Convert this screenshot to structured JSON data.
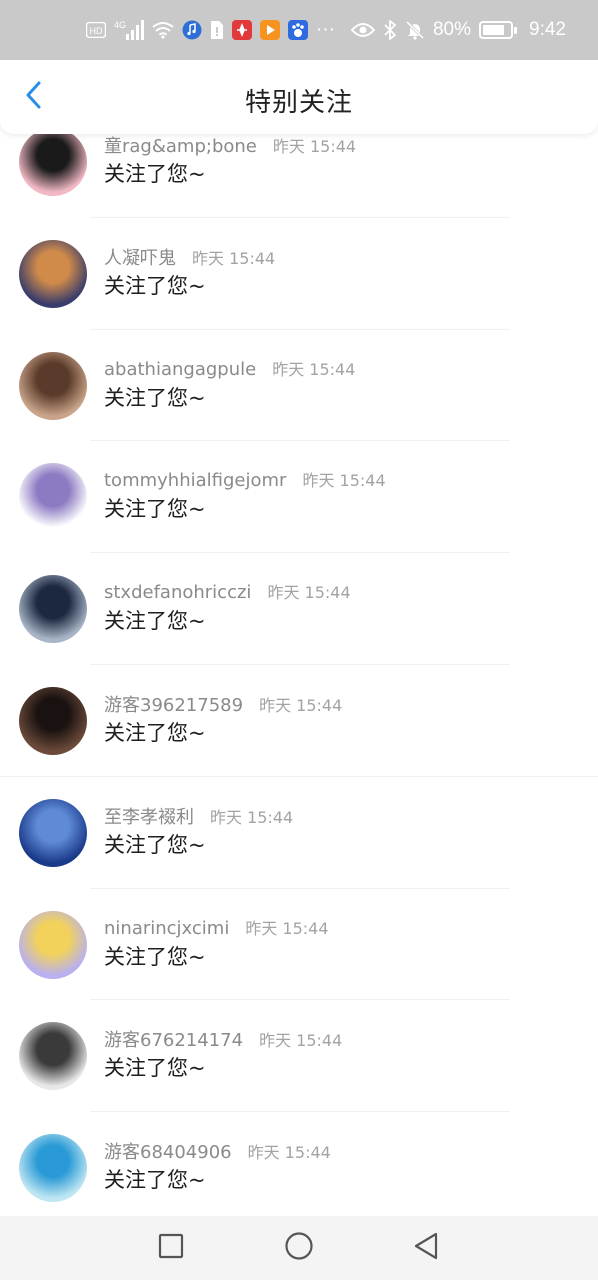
{
  "status_bar": {
    "left_icons": [
      "hd-icon",
      "signal-icon",
      "wifi-icon",
      "music-app-icon",
      "sim-icon",
      "huawei-app-icon",
      "video-app-icon",
      "baidu-app-icon",
      "more-dots-icon"
    ],
    "hd_label": "HD",
    "network_label": "4G",
    "more_label": "···",
    "battery_percent": "80%",
    "battery_level": 0.8,
    "time": "9:42"
  },
  "header": {
    "title": "特别关注",
    "back_icon": "chevron-left-icon",
    "accent_color": "#2b8ee6"
  },
  "items": [
    {
      "name": "童rag&amp;bone",
      "time": "昨天 15:44",
      "message": "关注了您~",
      "avatar": [
        "#f2b9c4",
        "#1a1a1a"
      ]
    },
    {
      "name": "人凝吓鬼",
      "time": "昨天 15:44",
      "message": "关注了您~",
      "avatar": [
        "#3a3d6b",
        "#d08a4a"
      ]
    },
    {
      "name": "abathiangagpule",
      "time": "昨天 15:44",
      "message": "关注了您~",
      "avatar": [
        "#c9a48a",
        "#5a3a2a"
      ]
    },
    {
      "name": "tommyhhialfigejomr",
      "time": "昨天 15:44",
      "message": "关注了您~",
      "avatar": [
        "#ffffff",
        "#8c7ac2"
      ]
    },
    {
      "name": "stxdefanohricczi",
      "time": "昨天 15:44",
      "message": "关注了您~",
      "avatar": [
        "#a7b5c6",
        "#1c2740"
      ]
    },
    {
      "name": "游客396217589",
      "time": "昨天 15:44",
      "message": "关注了您~",
      "avatar": [
        "#6b4a3a",
        "#1a1210"
      ]
    },
    {
      "name": "至李孝裰利",
      "time": "昨天 15:44",
      "message": "关注了您~",
      "avatar": [
        "#1a3a8a",
        "#5f8ad6"
      ]
    },
    {
      "name": "ninarincjxcimi",
      "time": "昨天 15:44",
      "message": "关注了您~",
      "avatar": [
        "#b8b0f0",
        "#f2d25a"
      ]
    },
    {
      "name": "游客676214174",
      "time": "昨天 15:44",
      "message": "关注了您~",
      "avatar": [
        "#e8e8e8",
        "#3a3a3a"
      ]
    },
    {
      "name": "游客68404906",
      "time": "昨天 15:44",
      "message": "关注了您~",
      "avatar": [
        "#bfe6f2",
        "#2a9ad6"
      ]
    }
  ],
  "nav_bar": {
    "recent_icon": "square-icon",
    "home_icon": "circle-icon",
    "back_icon": "triangle-back-icon"
  }
}
